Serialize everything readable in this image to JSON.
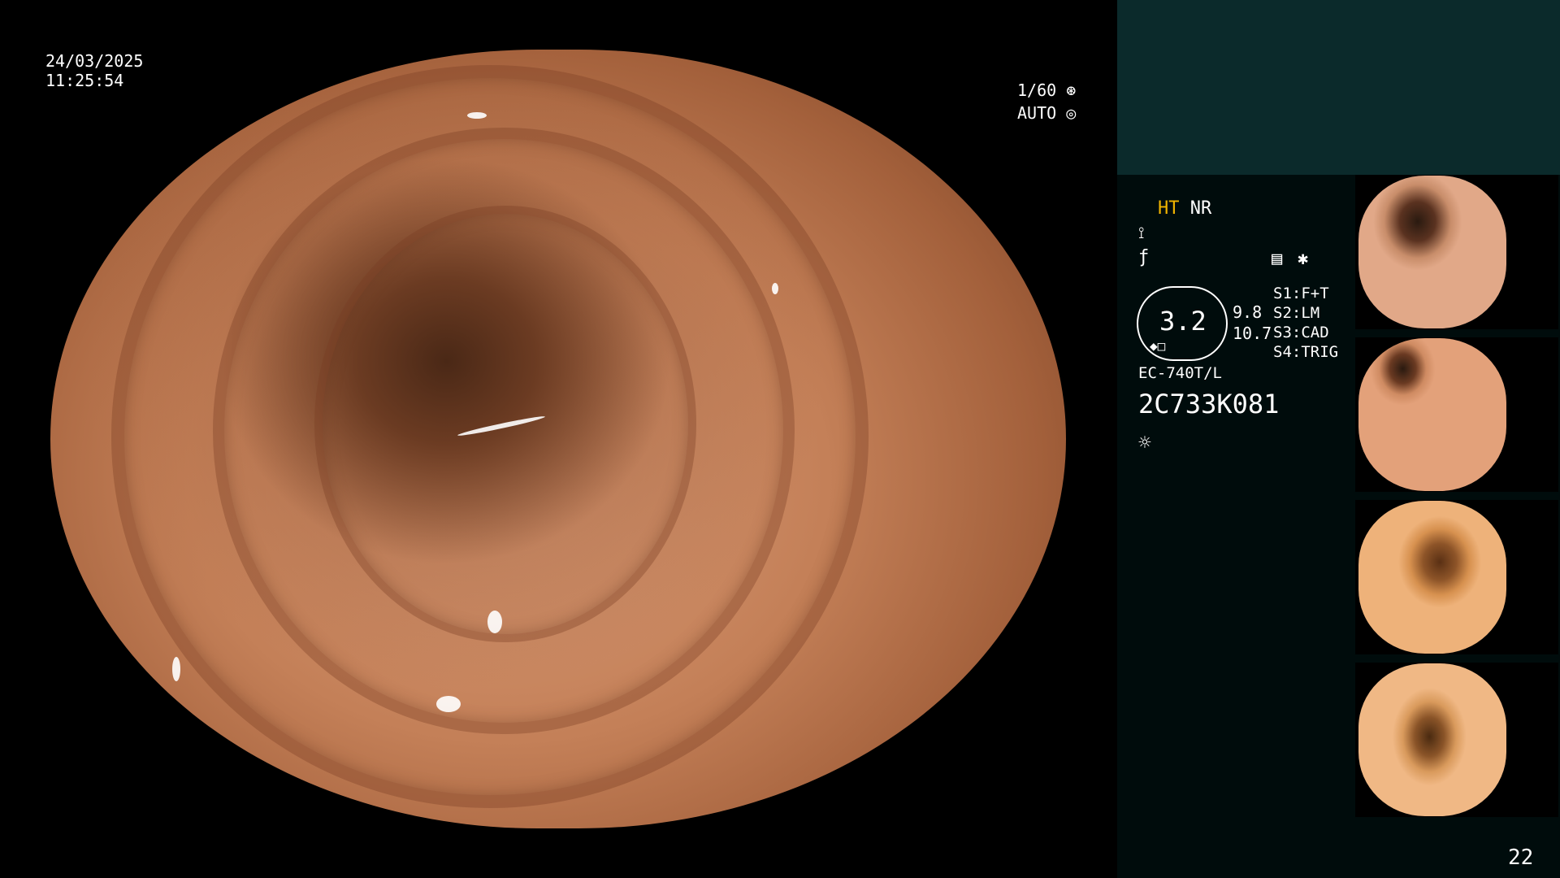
{
  "osd": {
    "date": "24/03/2025",
    "time": "11:25:54",
    "shutter": "1/60",
    "iris": "AUTO"
  },
  "panel": {
    "mode_ht": "HT",
    "mode_nr": "NR",
    "enhance_value": "3.2",
    "enhance_a": "9.8",
    "enhance_b": "10.7",
    "s1": "S1:F+T",
    "s2": "S2:LM",
    "s3": "S3:CAD",
    "s4": "S4:TRIG",
    "model": "EC-740T/L",
    "serial": "2C733K081",
    "page_number": "22"
  },
  "colors": {
    "ht_accent": "#f0b400",
    "panel_top": "#0b2a2b",
    "panel_bg": "#000c0c"
  },
  "thumbnails": [
    {
      "name": "thumbnail-1"
    },
    {
      "name": "thumbnail-2"
    },
    {
      "name": "thumbnail-3"
    },
    {
      "name": "thumbnail-4"
    }
  ]
}
